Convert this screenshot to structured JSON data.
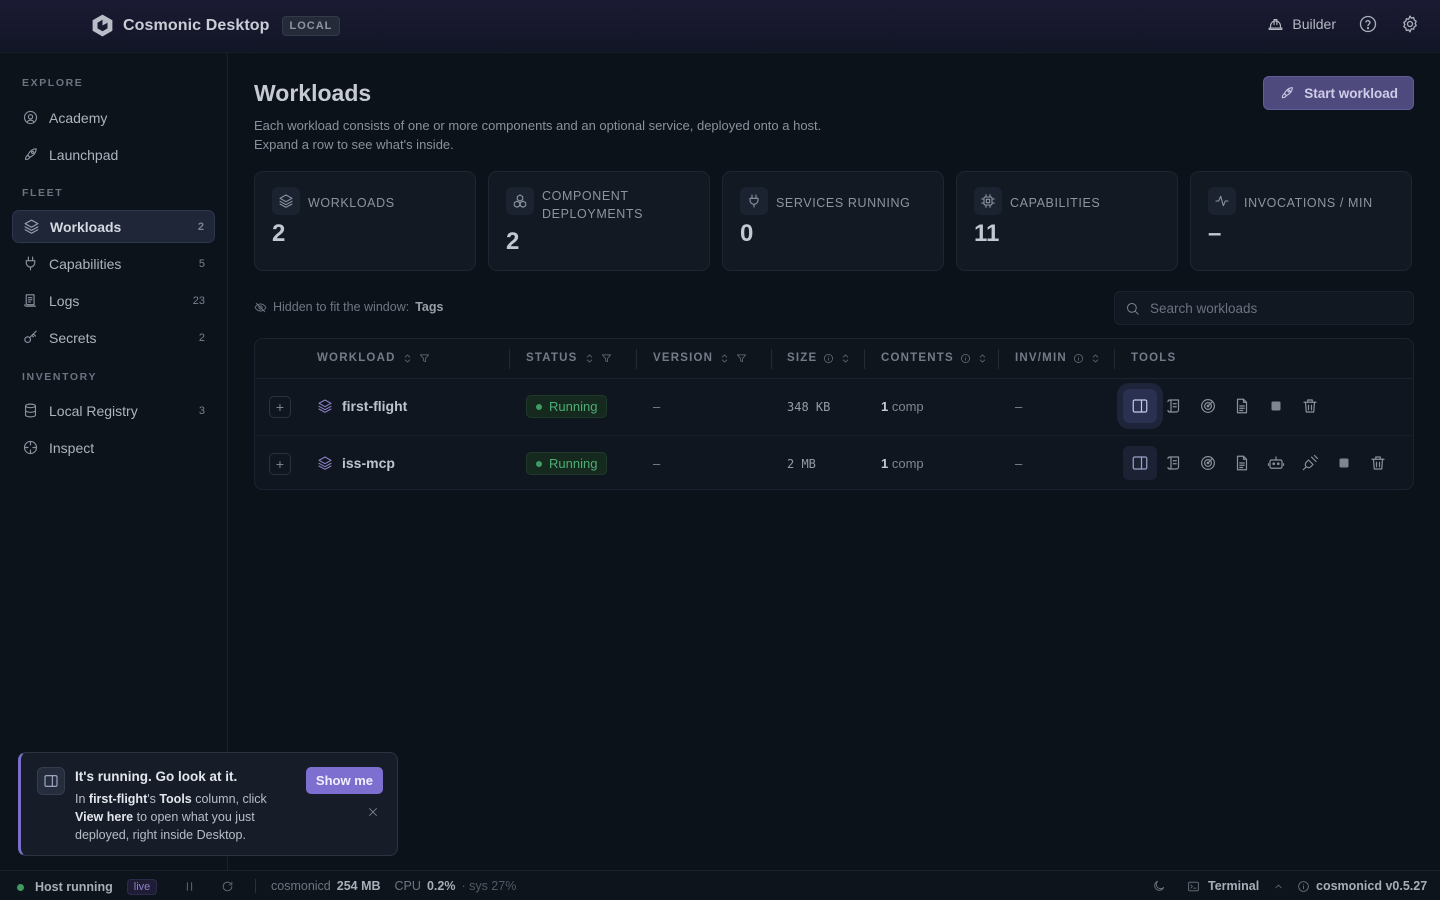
{
  "app": {
    "title": "Cosmonic Desktop",
    "badge": "LOCAL"
  },
  "topbar": {
    "builder_label": "Builder",
    "icons": [
      "hardhat-icon",
      "help-icon",
      "gear-icon"
    ]
  },
  "sidebar": {
    "sections": [
      {
        "label": "EXPLORE",
        "items": [
          {
            "label": "Academy",
            "icon": "academy-icon",
            "count": ""
          },
          {
            "label": "Launchpad",
            "icon": "rocket-icon",
            "count": ""
          }
        ]
      },
      {
        "label": "FLEET",
        "items": [
          {
            "label": "Workloads",
            "icon": "layers-icon",
            "count": "2",
            "active": true
          },
          {
            "label": "Capabilities",
            "icon": "plug-icon",
            "count": "5"
          },
          {
            "label": "Logs",
            "icon": "logs-icon",
            "count": "23"
          },
          {
            "label": "Secrets",
            "icon": "key-icon",
            "count": "2"
          }
        ]
      },
      {
        "label": "INVENTORY",
        "items": [
          {
            "label": "Local Registry",
            "icon": "database-icon",
            "count": "3"
          },
          {
            "label": "Inspect",
            "icon": "inspect-icon",
            "count": ""
          }
        ]
      }
    ]
  },
  "page": {
    "title": "Workloads",
    "desc1": "Each workload consists of one or more components and an optional service, deployed onto a host.",
    "desc2": "Expand a row to see what's inside.",
    "start_button": "Start workload"
  },
  "stats": [
    {
      "label": "WORKLOADS",
      "value": "2",
      "icon": "layers-icon"
    },
    {
      "label": "COMPONENT DEPLOYMENTS",
      "value": "2",
      "icon": "components-icon"
    },
    {
      "label": "SERVICES RUNNING",
      "value": "0",
      "icon": "plug-icon"
    },
    {
      "label": "CAPABILITIES",
      "value": "11",
      "icon": "chip-icon"
    },
    {
      "label": "INVOCATIONS / MIN",
      "value": "–",
      "icon": "activity-icon"
    }
  ],
  "hidden_note": {
    "prefix": "Hidden to fit the window:",
    "value": "Tags"
  },
  "search": {
    "placeholder": "Search workloads",
    "value": ""
  },
  "table": {
    "columns": [
      "WORKLOAD",
      "STATUS",
      "VERSION",
      "SIZE",
      "CONTENTS",
      "INV/MIN",
      "TOOLS"
    ],
    "rows": [
      {
        "name": "first-flight",
        "status": "Running",
        "version": "–",
        "size": "348 KB",
        "contents_count": "1",
        "contents_unit": "comp",
        "invmin": "–"
      },
      {
        "name": "iss-mcp",
        "status": "Running",
        "version": "–",
        "size": "2 MB",
        "contents_count": "1",
        "contents_unit": "comp",
        "invmin": "–"
      }
    ]
  },
  "toast": {
    "title": "It's running. Go look at it.",
    "body_1": "In ",
    "body_name": "first-flight",
    "body_2": "'s ",
    "body_tools": "Tools",
    "body_3": " column, click ",
    "body_view": "View here",
    "body_4": " to open what you just deployed, right inside Desktop.",
    "show_me": "Show me"
  },
  "statusbar": {
    "host": "Host running",
    "live": "live",
    "proc": "cosmonicd",
    "mem": "254 MB",
    "cpu_label": "CPU",
    "cpu": "0.2%",
    "sys": "· sys 27%",
    "terminal": "Terminal",
    "version": "cosmonicd v0.5.27"
  },
  "colors": {
    "accent": "#7d6fd0",
    "running": "#4caf73",
    "bg": "#0c1219"
  }
}
